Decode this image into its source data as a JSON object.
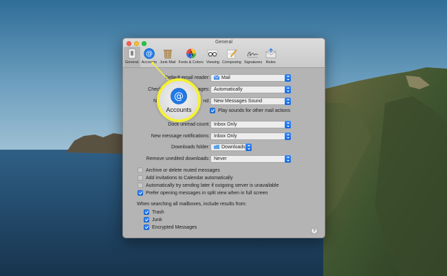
{
  "window": {
    "title": "General"
  },
  "toolbar": {
    "items": [
      {
        "label": "General",
        "icon": "switch-icon",
        "selected": true
      },
      {
        "label": "Accounts",
        "icon": "at-icon"
      },
      {
        "label": "Junk Mail",
        "icon": "trash-bin-icon"
      },
      {
        "label": "Fonts & Colors",
        "icon": "color-wheel-icon"
      },
      {
        "label": "Viewing",
        "icon": "glasses-icon"
      },
      {
        "label": "Composing",
        "icon": "pencil-paper-icon"
      },
      {
        "label": "Signatures",
        "icon": "signature-icon"
      },
      {
        "label": "Rules",
        "icon": "envelope-rules-icon"
      }
    ]
  },
  "settings": {
    "default_reader": {
      "label": "Default email reader:",
      "value": "Mail"
    },
    "check_messages": {
      "label_visible": "Check",
      "label_tail": "ages:",
      "value": "Automatically"
    },
    "new_sound": {
      "label_head": "N",
      "label_tail": "nd:",
      "value": "New Messages Sound"
    },
    "play_sounds": {
      "label": "Play sounds for other mail actions",
      "checked": true
    },
    "dock_count": {
      "label": "Dock unread count:",
      "value": "Inbox Only"
    },
    "notifications": {
      "label": "New message notifications:",
      "value": "Inbox Only"
    },
    "downloads_folder": {
      "label": "Downloads folder:",
      "value": "Downloads"
    },
    "remove_downloads": {
      "label": "Remove unedited downloads:",
      "value": "Never"
    }
  },
  "options": [
    {
      "label": "Archive or delete muted messages",
      "checked": false
    },
    {
      "label": "Add invitations to Calendar automatically",
      "checked": false
    },
    {
      "label": "Automatically try sending later if outgoing server is unavailable",
      "checked": false
    },
    {
      "label": "Prefer opening messages in split view when in full screen",
      "checked": true
    }
  ],
  "search": {
    "heading": "When searching all mailboxes, include results from:",
    "items": [
      {
        "label": "Trash",
        "checked": true
      },
      {
        "label": "Junk",
        "checked": true
      },
      {
        "label": "Encrypted Messages",
        "checked": true
      }
    ]
  },
  "help": {
    "label": "?"
  },
  "callout": {
    "label": "Accounts",
    "icon": "at-icon",
    "color": "#f5f035"
  },
  "colors": {
    "accent": "#1469e0",
    "highlight": "#f5f035"
  }
}
